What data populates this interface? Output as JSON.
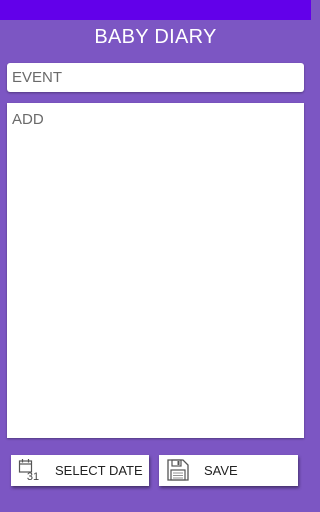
{
  "app": {
    "title": "BABY DIARY"
  },
  "form": {
    "event_placeholder": "EVENT",
    "add_placeholder": "ADD"
  },
  "buttons": {
    "select_date": {
      "label": "SELECT DATE",
      "icon": "calendar-icon",
      "icon_text": "31"
    },
    "save": {
      "label": "SAVE",
      "icon": "floppy-disk-icon"
    }
  },
  "colors": {
    "status_bar": "#6200ea",
    "background": "#7c56c3",
    "field": "#ffffff"
  }
}
